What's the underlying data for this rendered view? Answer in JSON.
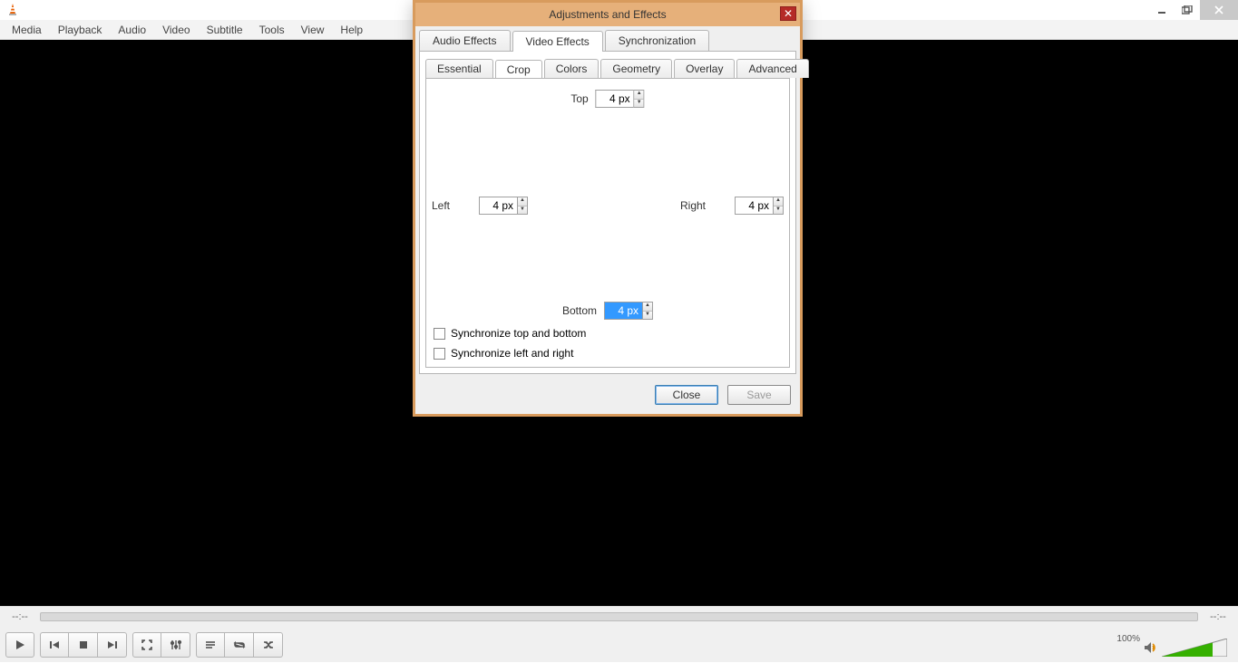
{
  "menubar": {
    "items": [
      "Media",
      "Playback",
      "Audio",
      "Video",
      "Subtitle",
      "Tools",
      "View",
      "Help"
    ]
  },
  "seek": {
    "left": "--:--",
    "right": "--:--"
  },
  "volume": {
    "label": "100%"
  },
  "dialog": {
    "title": "Adjustments and Effects",
    "tabs": {
      "audio": "Audio Effects",
      "video": "Video Effects",
      "sync": "Synchronization",
      "active": "video"
    },
    "subtabs": {
      "essential": "Essential",
      "crop": "Crop",
      "colors": "Colors",
      "geometry": "Geometry",
      "overlay": "Overlay",
      "advanced": "Advanced",
      "active": "crop"
    },
    "crop": {
      "top_label": "Top",
      "top_value": "4 px",
      "left_label": "Left",
      "left_value": "4 px",
      "right_label": "Right",
      "right_value": "4 px",
      "bottom_label": "Bottom",
      "bottom_value": "4 px",
      "sync_tb": "Synchronize top and bottom",
      "sync_lr": "Synchronize left and right"
    },
    "buttons": {
      "close": "Close",
      "save": "Save"
    }
  }
}
